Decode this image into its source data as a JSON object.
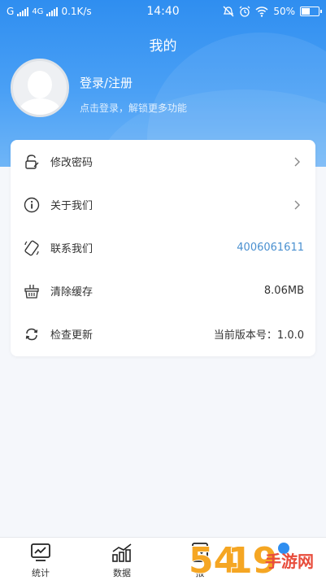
{
  "status_bar": {
    "carrier1": "G",
    "network": "4G",
    "speed": "0.1K/s",
    "time": "14:40",
    "battery": "50%",
    "battery_level": 0.5
  },
  "header": {
    "title": "我的",
    "login_label": "登录/注册",
    "login_hint": "点击登录，解锁更多功能"
  },
  "menu": {
    "items": [
      {
        "label": "修改密码",
        "value": "",
        "chevron": true
      },
      {
        "label": "关于我们",
        "value": "",
        "chevron": true
      },
      {
        "label": "联系我们",
        "value": "4006061611",
        "chevron": false
      },
      {
        "label": "清除缓存",
        "value": "8.06MB",
        "chevron": false
      },
      {
        "label": "检查更新",
        "value": "当前版本号：1.0.0",
        "chevron": false
      }
    ]
  },
  "tabbar": {
    "tabs": [
      {
        "label": "统计",
        "icon": "chart-icon"
      },
      {
        "label": "数据",
        "icon": "bar-chart-icon"
      },
      {
        "label": "报",
        "icon": "report-icon"
      }
    ]
  },
  "watermark": {
    "text": "手游网",
    "site": "5419"
  },
  "colors": {
    "primary": "#2f8ef0",
    "link": "#4a90d0",
    "background": "#f5f7fb"
  }
}
